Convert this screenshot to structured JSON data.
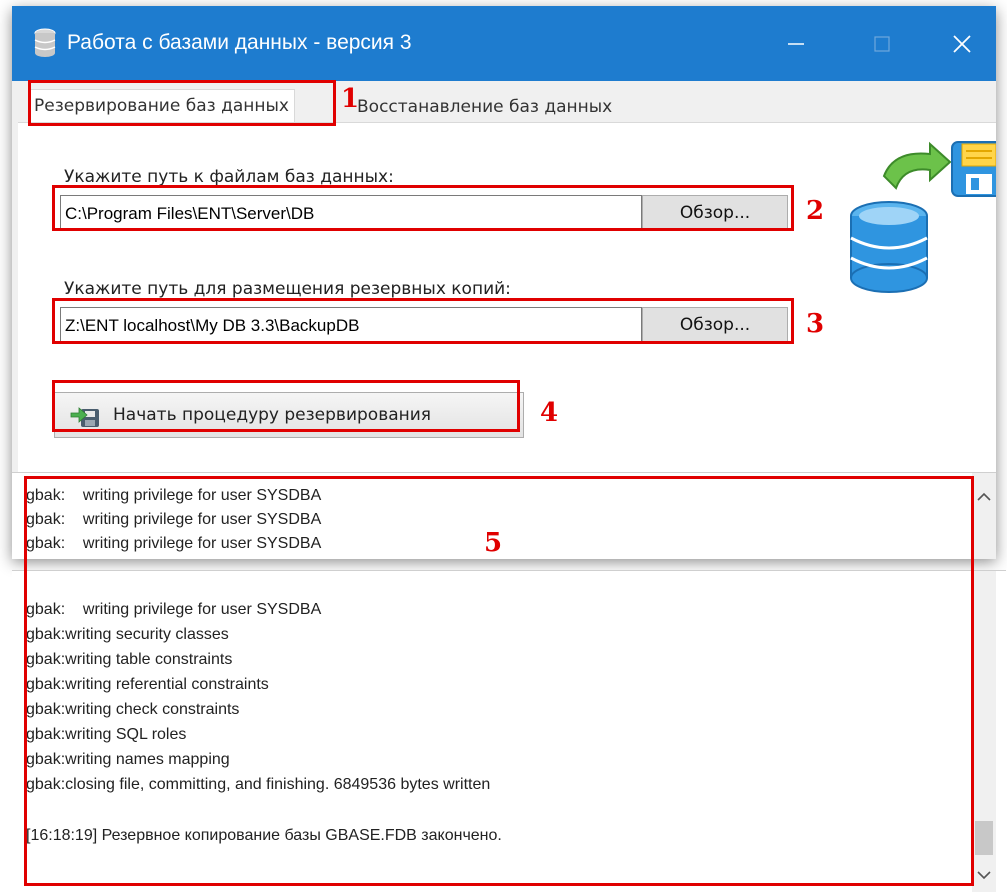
{
  "window": {
    "title": "Работа с базами данных - версия 3",
    "minimize_icon": "minimize-icon",
    "maximize_icon": "maximize-icon",
    "close_icon": "close-icon"
  },
  "tabs": [
    {
      "label": "Резервирование баз данных",
      "active": true
    },
    {
      "label": "Восстанавление баз данных",
      "active": false
    }
  ],
  "form": {
    "source_label": "Укажите путь к файлам баз данных:",
    "source_value": "C:\\Program Files\\ENT\\Server\\DB",
    "browse_label": "Обзор...",
    "backup_label": "Укажите путь для размещения резервных копий:",
    "backup_value": "Z:\\ENT localhost\\My DB 3.3\\BackupDB",
    "start_label": "Начать процедуру резервирования"
  },
  "markers": [
    "1",
    "2",
    "3",
    "4",
    "5"
  ],
  "log_top": [
    "gbak:    writing privilege for user SYSDBA",
    "gbak:    writing privilege for user SYSDBA",
    "gbak:    writing privilege for user SYSDBA"
  ],
  "log_bottom": [
    "gbak:    writing privilege for user SYSDBA",
    "gbak:writing security classes",
    "gbak:writing table constraints",
    "gbak:writing referential constraints",
    "gbak:writing check constraints",
    "gbak:writing SQL roles",
    "gbak:writing names mapping",
    "gbak:closing file, committing, and finishing. 6849536 bytes written",
    "",
    "[16:18:19] Резервное копирование базы GBASE.FDB закончено."
  ],
  "colors": {
    "titlebar": "#1e7ccf",
    "highlight": "#e00000"
  }
}
